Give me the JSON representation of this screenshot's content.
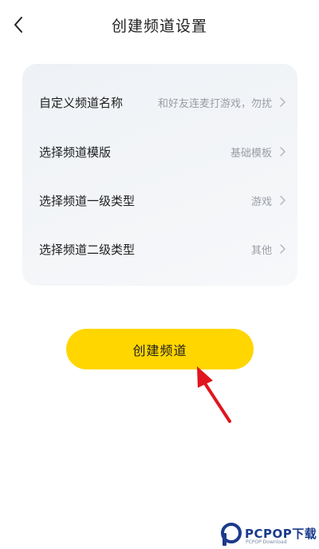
{
  "header": {
    "title": "创建频道设置",
    "back_icon": "chevron-left-icon"
  },
  "settings": {
    "rows": [
      {
        "label": "自定义频道名称",
        "value": "和好友连麦打游戏，勿扰"
      },
      {
        "label": "选择频道模版",
        "value": "基础模板"
      },
      {
        "label": "选择频道一级类型",
        "value": "游戏"
      },
      {
        "label": "选择频道二级类型",
        "value": "其他"
      }
    ],
    "chevron_icon": "chevron-right-icon"
  },
  "create_button": {
    "label": "创建频道",
    "color": "#FFD600"
  },
  "annotation": {
    "arrow_icon": "red-arrow-icon",
    "color": "#E0161E"
  },
  "watermark": {
    "text": "PCPOP下载",
    "subtext": "PCPOP Download"
  },
  "colors": {
    "accent": "#FFD600",
    "card_bg": "#F1F4F7",
    "value_text": "#9A9EA4"
  }
}
